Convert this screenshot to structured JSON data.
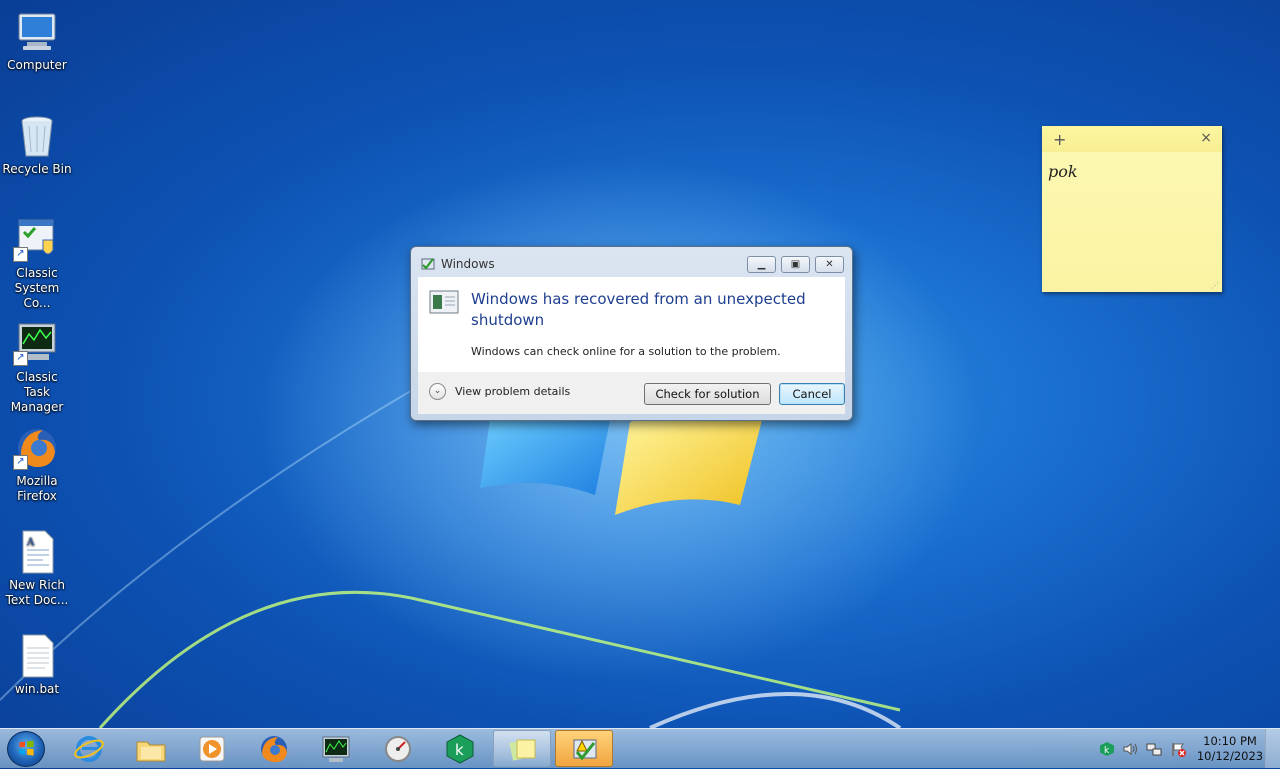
{
  "desktop": {
    "icons": [
      {
        "label": "Computer",
        "icon": "computer-icon"
      },
      {
        "label": "Recycle Bin",
        "icon": "recycle-bin-icon"
      },
      {
        "label": "Classic System Co...",
        "icon": "control-panel-icon"
      },
      {
        "label": "Classic Task Manager",
        "icon": "task-manager-icon"
      },
      {
        "label": "Mozilla Firefox",
        "icon": "firefox-icon"
      },
      {
        "label": "New Rich Text Doc...",
        "icon": "rich-text-document-icon"
      },
      {
        "label": "win.bat",
        "icon": "batch-file-icon"
      }
    ]
  },
  "sticky_note": {
    "add_glyph": "+",
    "close_glyph": "×",
    "text": "pok"
  },
  "dialog": {
    "title": "Windows",
    "headline": "Windows has recovered from an unexpected shutdown",
    "subtext": "Windows can check online for a solution to the problem.",
    "details_label": "View problem details",
    "check_button": "Check for solution",
    "cancel_button": "Cancel"
  },
  "taskbar": {
    "pinned": [
      "internet-explorer-icon",
      "explorer-folder-icon",
      "media-player-icon",
      "firefox-icon",
      "task-manager-icon",
      "speedometer-icon",
      "kaspersky-icon",
      "sticky-notes-icon",
      "problem-reports-icon"
    ],
    "tray": [
      "kaspersky-tray-icon",
      "volume-icon",
      "network-icon",
      "action-center-icon"
    ],
    "clock": {
      "time": "10:10 PM",
      "date": "10/12/2023"
    }
  }
}
